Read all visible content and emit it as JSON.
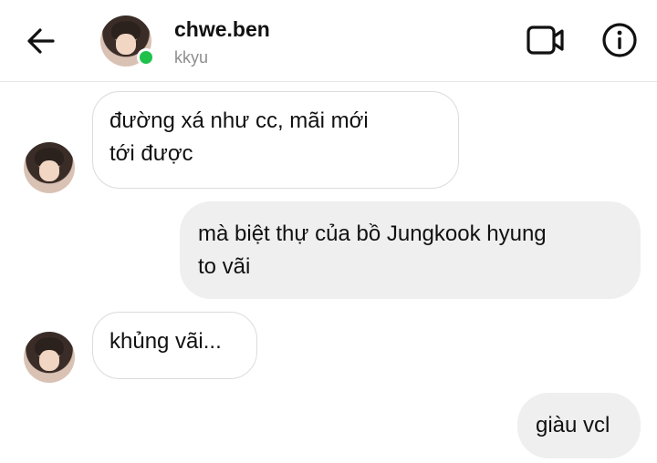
{
  "header": {
    "username": "chwe.ben",
    "subname": "kkyu",
    "status": "online",
    "status_color": "#1fc14b",
    "icons": {
      "back": "arrow-left-icon",
      "video": "video-camera-icon",
      "info": "info-icon"
    }
  },
  "messages": [
    {
      "direction": "incoming",
      "text": "đường xá như cc, mãi mới\ntới được"
    },
    {
      "direction": "outgoing",
      "text": "mà biệt thự của bồ Jungkook hyung\nto vãi"
    },
    {
      "direction": "incoming",
      "text": "khủng vãi..."
    },
    {
      "direction": "outgoing",
      "text": "giàu vcl"
    }
  ],
  "colors": {
    "incoming_bubble": "#ffffff",
    "incoming_border": "#dcdcdc",
    "outgoing_bubble": "#efefef",
    "subtext": "#8e8e8e"
  }
}
